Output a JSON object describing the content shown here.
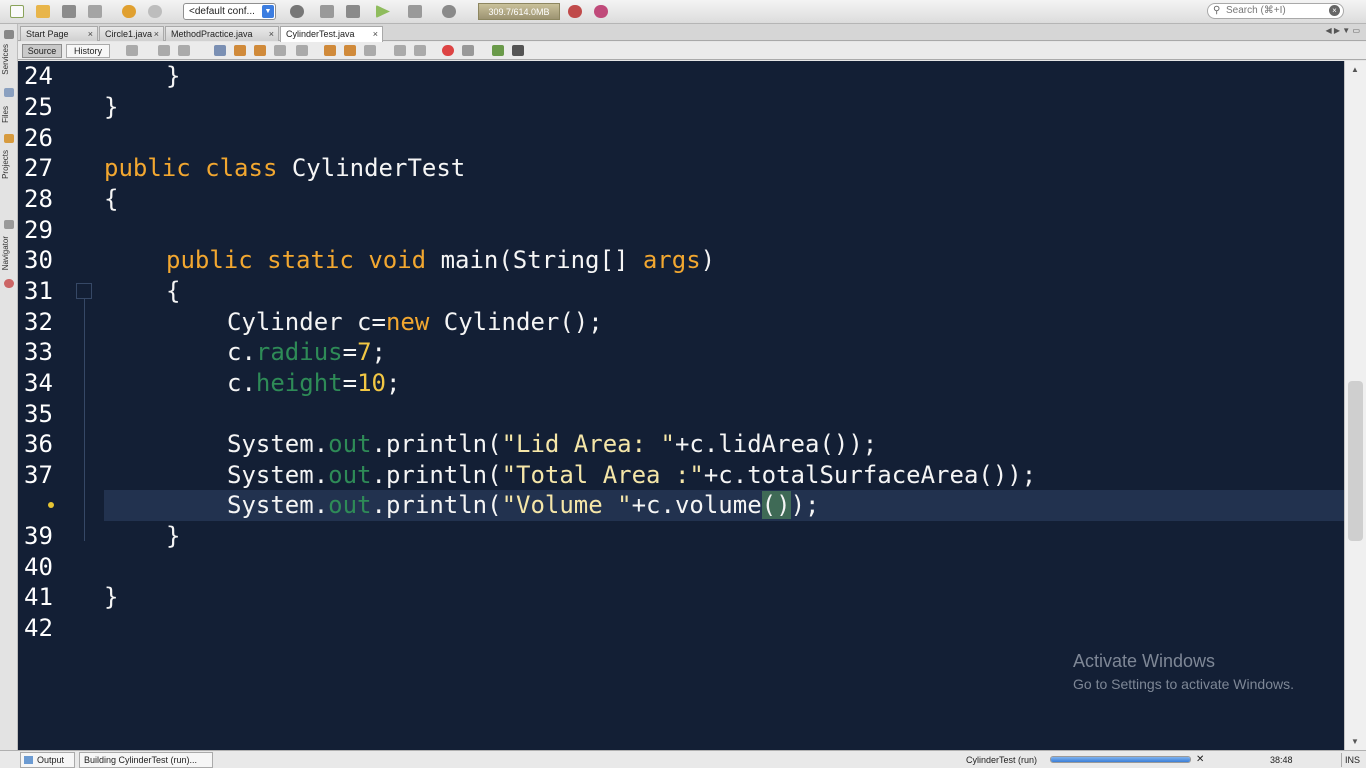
{
  "toolbar": {
    "config": "<default conf...",
    "memory": "309.7/614.0MB",
    "search_placeholder": "Search (⌘+I)"
  },
  "sidebar": {
    "services": "Services",
    "files": "Files",
    "projects": "Projects",
    "navigator": "Navigator"
  },
  "tabs": [
    {
      "label": "Start Page"
    },
    {
      "label": "Circle1.java"
    },
    {
      "label": "MethodPractice.java"
    },
    {
      "label": "CylinderTest.java"
    }
  ],
  "editor_toolbar": {
    "source": "Source",
    "history": "History"
  },
  "code": {
    "line_numbers": [
      "24",
      "25",
      "26",
      "27",
      "28",
      "29",
      "30",
      "31",
      "32",
      "33",
      "34",
      "35",
      "36",
      "37",
      "",
      "39",
      "40",
      "41",
      "42"
    ],
    "lines": {
      "l24": "}",
      "l25": "}",
      "l27_kw1": "public",
      "l27_kw2": "class",
      "l27_name": "CylinderTest",
      "l28": "{",
      "l30_kw1": "public",
      "l30_kw2": "static",
      "l30_kw3": "void",
      "l30_main": "main(String[]",
      "l30_args": "args",
      "l30_end": ")",
      "l31": "{",
      "l32_a": "Cylinder c=",
      "l32_new": "new",
      "l32_b": " Cylinder();",
      "l33_c": "c.",
      "l33_field": "radius",
      "l33_eq": "=",
      "l33_num": "7",
      "l33_end": ";",
      "l34_c": "c.",
      "l34_field": "height",
      "l34_eq": "=",
      "l34_num": "10",
      "l34_end": ";",
      "l36_sys": "System.",
      "l36_out": "out",
      "l36_pr": ".println(",
      "l36_str": "\"Lid Area: \"",
      "l36_end": "+c.lidArea());",
      "l37_sys": "System.",
      "l37_out": "out",
      "l37_pr": ".println(",
      "l37_str": "\"Total Area :\"",
      "l37_end": "+c.totalSurfaceArea());",
      "l38_sys": "System.",
      "l38_out": "out",
      "l38_pr": ".println(",
      "l38_str": "\"Volume \"",
      "l38_mid": "+c.volume",
      "l38_par": "()",
      "l38_end": ");",
      "l39": "}",
      "l41": "}"
    }
  },
  "watermark": {
    "title": "Activate Windows",
    "subtitle": "Go to Settings to activate Windows."
  },
  "status": {
    "output": "Output",
    "building": "Building CylinderTest (run)...",
    "run_label": "CylinderTest (run)",
    "progress": 1.0,
    "time": "38:48",
    "mode": "INS"
  }
}
